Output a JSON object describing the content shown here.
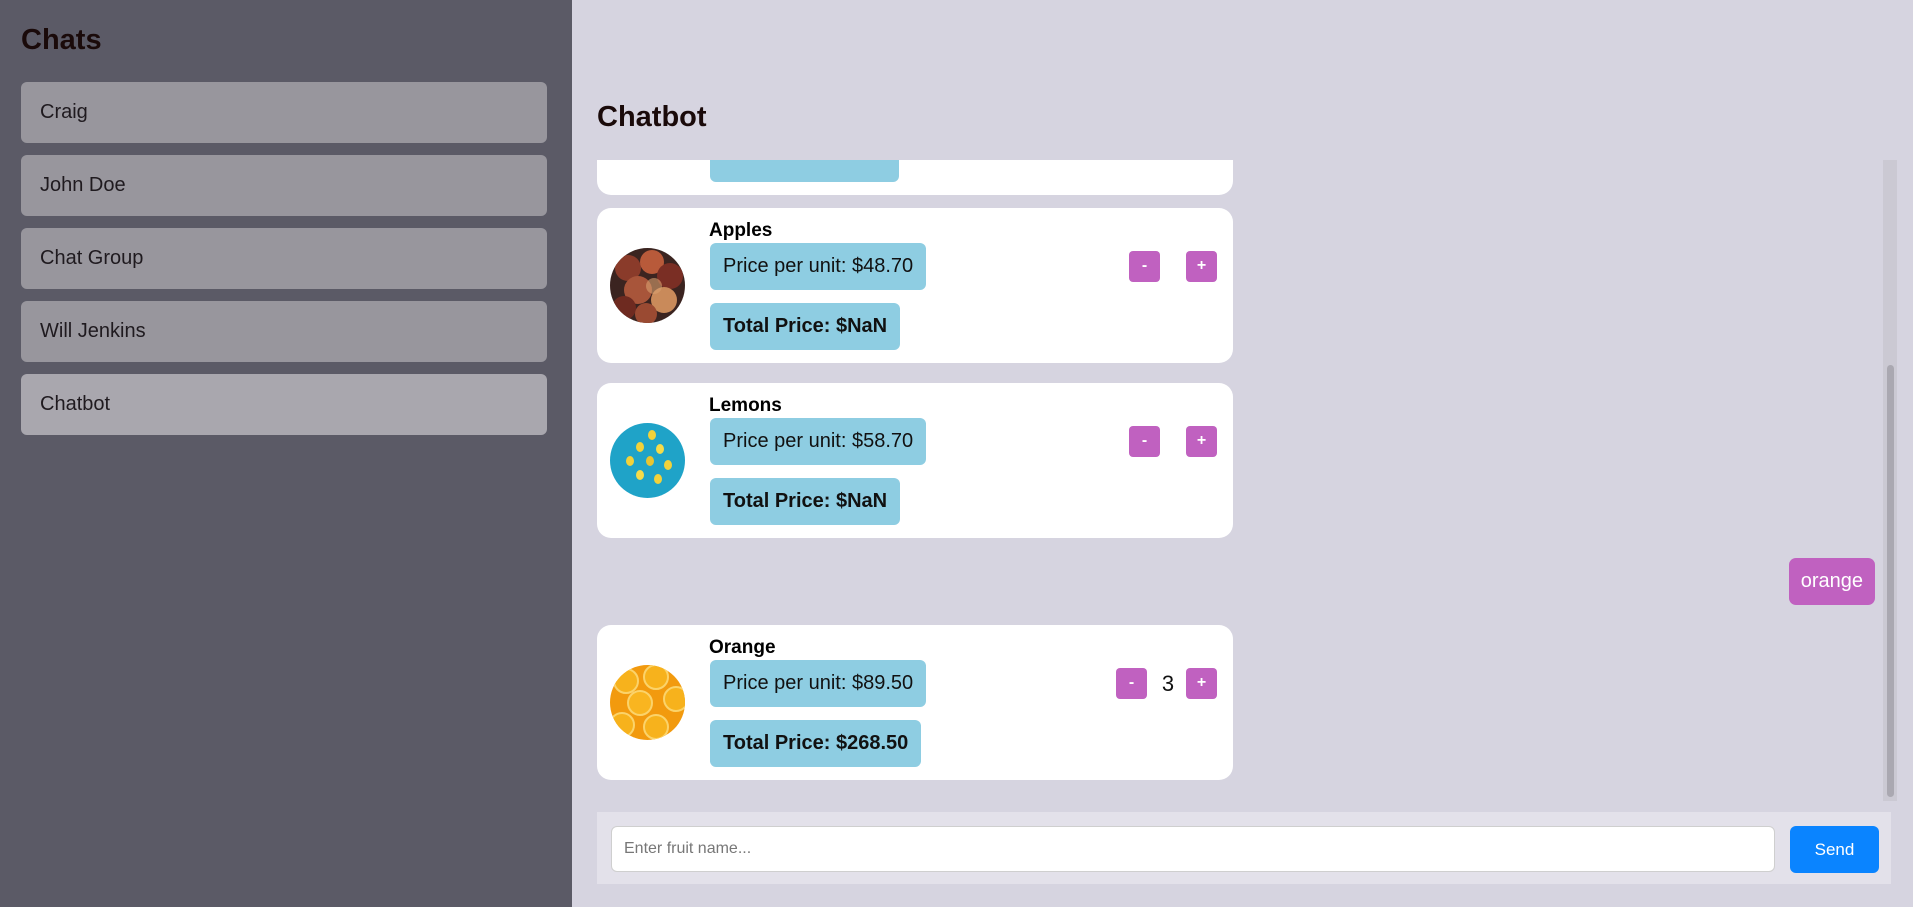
{
  "sidebar": {
    "title": "Chats",
    "items": [
      {
        "label": "Craig"
      },
      {
        "label": "John Doe"
      },
      {
        "label": "Chat Group"
      },
      {
        "label": "Will Jenkins"
      },
      {
        "label": "Chatbot"
      }
    ]
  },
  "main": {
    "title": "Chatbot"
  },
  "messages": {
    "cards": [
      {
        "name": "Apples",
        "unit_price": "Price per unit: $48.70",
        "total": "Total Price: $NaN",
        "qty": "",
        "minus": "-",
        "plus": "+"
      },
      {
        "name": "Lemons",
        "unit_price": "Price per unit: $58.70",
        "total": "Total Price: $NaN",
        "qty": "",
        "minus": "-",
        "plus": "+"
      },
      {
        "name": "Orange",
        "unit_price": "Price per unit: $89.50",
        "total": "Total Price: $268.50",
        "qty": "3",
        "minus": "-",
        "plus": "+"
      }
    ],
    "user_message": "orange"
  },
  "composer": {
    "placeholder": "Enter fruit name...",
    "send_label": "Send"
  },
  "colors": {
    "accent": "#c061c0",
    "price_pill": "#8ecde2",
    "send": "#0a84ff"
  }
}
